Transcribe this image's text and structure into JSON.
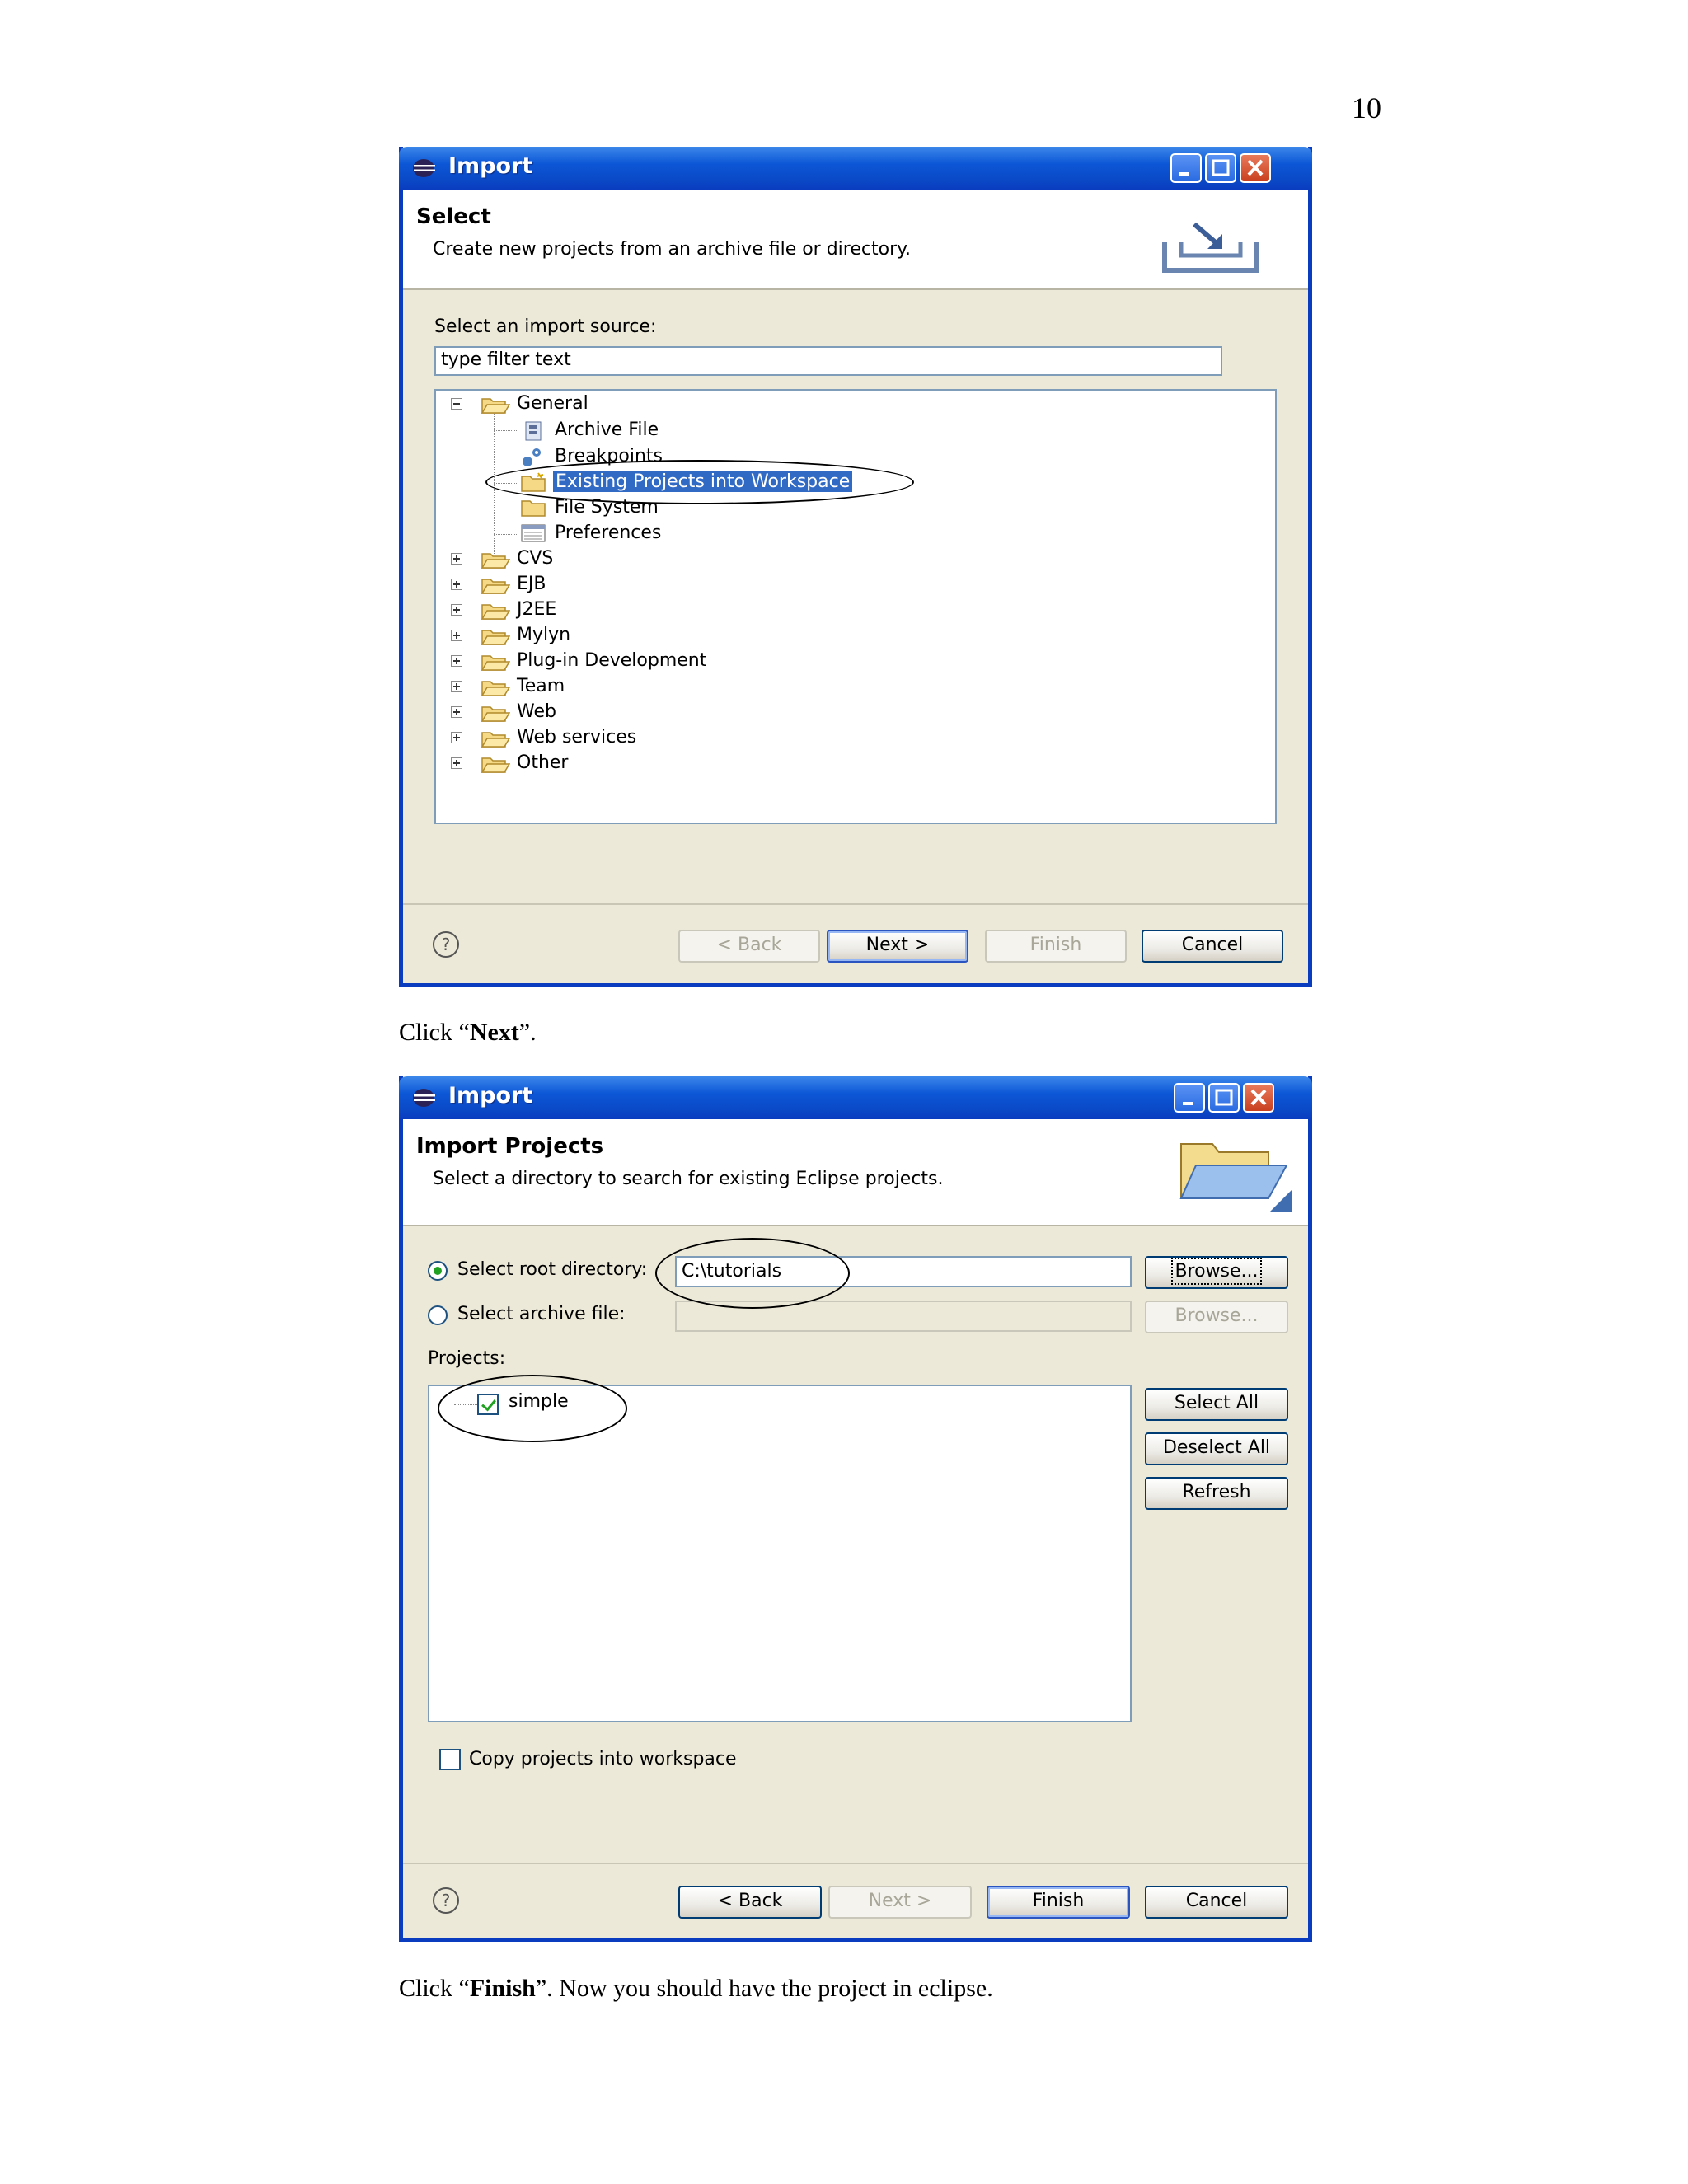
{
  "page": {
    "number": "10"
  },
  "dialog1": {
    "title": "Import",
    "heading": "Select",
    "description": "Create new projects from an archive file or directory.",
    "source_label": "Select an import source:",
    "filter_value": "type filter text",
    "tree": {
      "general": "General",
      "children": [
        "Archive File",
        "Breakpoints",
        "Existing Projects into Workspace",
        "File System",
        "Preferences"
      ],
      "selected": "Existing Projects into Workspace",
      "folders": [
        "CVS",
        "EJB",
        "J2EE",
        "Mylyn",
        "Plug-in Development",
        "Team",
        "Web",
        "Web services",
        "Other"
      ]
    },
    "buttons": {
      "back": "< Back",
      "next": "Next >",
      "finish": "Finish",
      "cancel": "Cancel"
    }
  },
  "caption1": {
    "before": "Click “",
    "bold": "Next",
    "after": "”."
  },
  "dialog2": {
    "title": "Import",
    "heading": "Import Projects",
    "description": "Select a directory to search for existing Eclipse projects.",
    "root_dir_label": "Select root directory:",
    "root_dir_value": "C:\\tutorials",
    "archive_label": "Select archive file:",
    "browse_label": "Browse...",
    "projects_label": "Projects:",
    "projects": [
      {
        "name": "simple",
        "checked": true
      }
    ],
    "side_buttons": {
      "select_all": "Select All",
      "deselect_all": "Deselect All",
      "refresh": "Refresh"
    },
    "copy_label": "Copy projects into workspace",
    "buttons": {
      "back": "< Back",
      "next": "Next >",
      "finish": "Finish",
      "cancel": "Cancel"
    }
  },
  "caption2": {
    "before": "Click “",
    "bold": "Finish",
    "after": "”. Now you should have the project in eclipse."
  }
}
